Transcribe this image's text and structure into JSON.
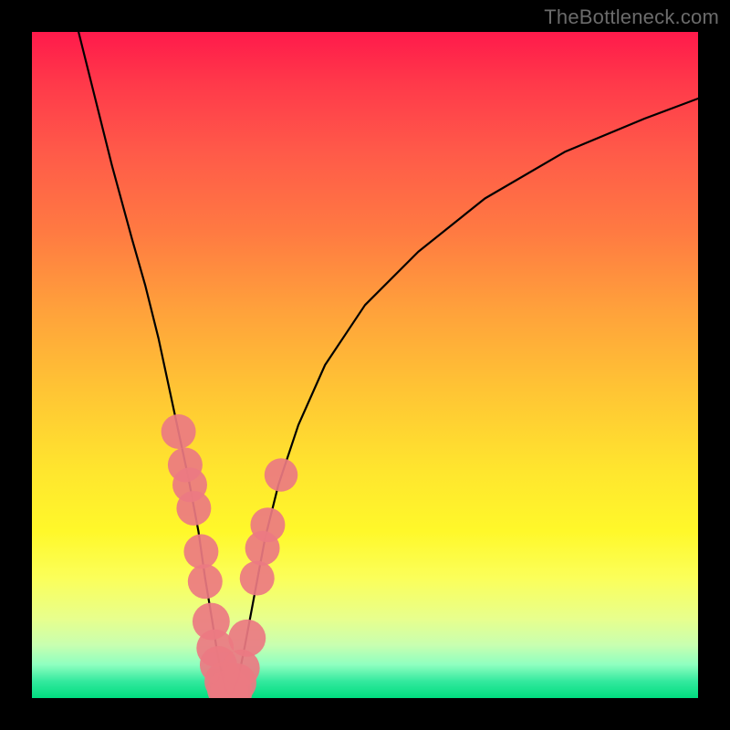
{
  "watermark": "TheBottleneck.com",
  "chart_data": {
    "type": "line",
    "title": "",
    "xlabel": "",
    "ylabel": "",
    "xlim": [
      0,
      100
    ],
    "ylim": [
      0,
      100
    ],
    "background_gradient": {
      "top": "#ff1a4b",
      "mid": "#ffe62e",
      "bottom": "#00dd7f"
    },
    "series": [
      {
        "name": "curve",
        "color": "#000000",
        "x": [
          7,
          9,
          12,
          15,
          17,
          19,
          20.5,
          22,
          23.5,
          25,
          26,
          27,
          27.8,
          28.5,
          29,
          29.5,
          30,
          31,
          32,
          33.5,
          35,
          37,
          40,
          44,
          50,
          58,
          68,
          80,
          92,
          100
        ],
        "values": [
          100,
          92,
          80,
          69,
          62,
          54,
          47,
          40,
          33,
          25,
          18,
          12,
          7,
          3.5,
          1.5,
          0.6,
          0.6,
          3,
          8,
          16,
          24,
          32,
          41,
          50,
          59,
          67,
          75,
          82,
          87,
          90
        ]
      }
    ],
    "markers": [
      {
        "name": "beads",
        "color": "#eb7a82",
        "alpha": 0.92,
        "points": [
          {
            "x": 22.0,
            "y": 40.0,
            "r": 2.6
          },
          {
            "x": 23.0,
            "y": 35.0,
            "r": 2.6
          },
          {
            "x": 23.7,
            "y": 32.0,
            "r": 2.6
          },
          {
            "x": 24.3,
            "y": 28.5,
            "r": 2.6
          },
          {
            "x": 25.4,
            "y": 22.0,
            "r": 2.6
          },
          {
            "x": 26.0,
            "y": 17.5,
            "r": 2.6
          },
          {
            "x": 26.9,
            "y": 11.5,
            "r": 2.8
          },
          {
            "x": 27.5,
            "y": 7.5,
            "r": 2.8
          },
          {
            "x": 28.0,
            "y": 5.0,
            "r": 2.8
          },
          {
            "x": 28.8,
            "y": 2.5,
            "r": 2.9
          },
          {
            "x": 29.2,
            "y": 1.3,
            "r": 2.9
          },
          {
            "x": 29.6,
            "y": 0.8,
            "r": 2.9
          },
          {
            "x": 30.2,
            "y": 1.0,
            "r": 2.9
          },
          {
            "x": 30.8,
            "y": 2.3,
            "r": 2.9
          },
          {
            "x": 31.4,
            "y": 4.5,
            "r": 2.8
          },
          {
            "x": 32.3,
            "y": 9.0,
            "r": 2.8
          },
          {
            "x": 33.8,
            "y": 18.0,
            "r": 2.6
          },
          {
            "x": 34.6,
            "y": 22.5,
            "r": 2.6
          },
          {
            "x": 35.4,
            "y": 26.0,
            "r": 2.6
          },
          {
            "x": 37.4,
            "y": 33.5,
            "r": 2.5
          }
        ]
      }
    ]
  }
}
